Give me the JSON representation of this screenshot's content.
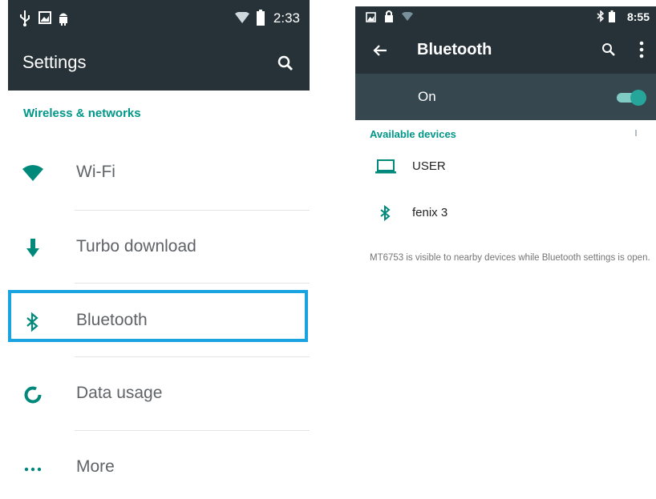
{
  "left": {
    "status": {
      "time": "2:33"
    },
    "appbar": {
      "title": "Settings",
      "search_icon": "search-icon"
    },
    "section": "Wireless & networks",
    "items": [
      {
        "label": "Wi-Fi",
        "icon": "wifi-icon"
      },
      {
        "label": "Turbo download",
        "icon": "download-arrow-icon"
      },
      {
        "label": "Bluetooth",
        "icon": "bluetooth-icon"
      },
      {
        "label": "Data usage",
        "icon": "data-usage-icon"
      },
      {
        "label": "More",
        "icon": "more-dots-icon"
      }
    ],
    "highlight_color": "#19a3e0"
  },
  "right": {
    "status": {
      "time": "8:55"
    },
    "appbar": {
      "title": "Bluetooth"
    },
    "toggle": {
      "label": "On",
      "state": "on"
    },
    "section": "Available devices",
    "devices": [
      {
        "name": "USER",
        "icon": "laptop-icon"
      },
      {
        "name": "fenix 3",
        "icon": "bluetooth-icon"
      }
    ],
    "note": "MT6753 is visible to nearby devices while Bluetooth settings is open."
  },
  "colors": {
    "accent": "#009688",
    "appbar": "#263238",
    "switchbar": "#37474f",
    "toggle_track": "#80cbc4",
    "toggle_thumb": "#26a69a"
  }
}
